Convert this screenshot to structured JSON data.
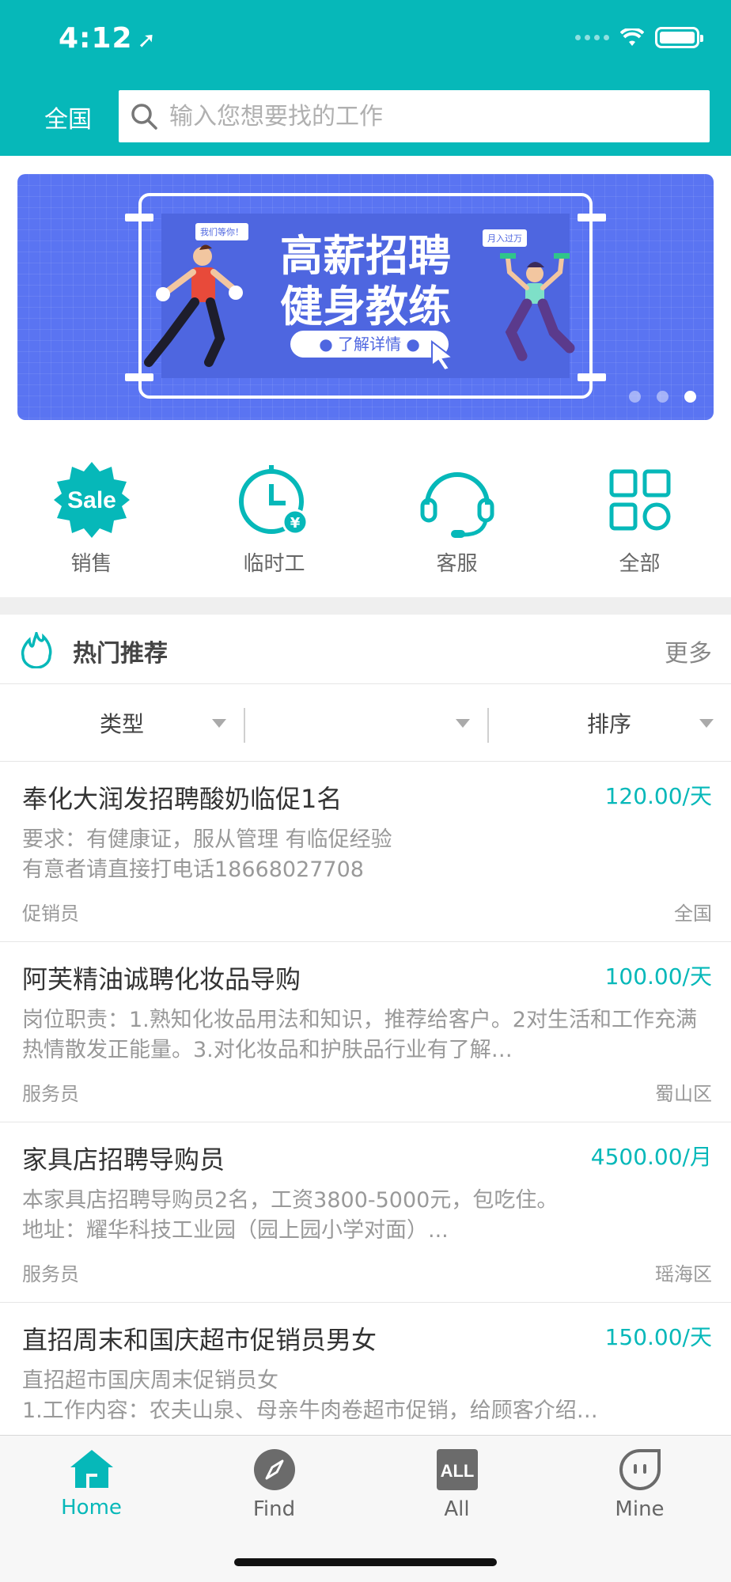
{
  "status_bar": {
    "time": "4:12"
  },
  "header": {
    "region": "全国",
    "search_placeholder": "输入您想要找的工作"
  },
  "banner": {
    "title_line1": "高薪招聘",
    "title_line2": "健身教练",
    "button": "● 了解详情 ●",
    "bubble_left": "我们等你！",
    "bubble_right": "月入过万",
    "page_count": 3,
    "active_page": 3
  },
  "categories": [
    {
      "label": "销售",
      "icon": "sale-badge-icon"
    },
    {
      "label": "临时工",
      "icon": "clock-yen-icon"
    },
    {
      "label": "客服",
      "icon": "headset-icon"
    },
    {
      "label": "全部",
      "icon": "grid-icon"
    }
  ],
  "hot": {
    "title": "热门推荐",
    "more": "更多"
  },
  "filters": [
    {
      "label": "类型"
    },
    {
      "label": ""
    },
    {
      "label": "排序"
    }
  ],
  "jobs": [
    {
      "title": "奉化大润发招聘酸奶临促1名",
      "salary": "120.00/天",
      "desc": "要求：有健康证，服从管理 有临促经验\n有意者请直接打电话18668027708",
      "category": "促销员",
      "area": "全国"
    },
    {
      "title": "阿芙精油诚聘化妆品导购",
      "salary": "100.00/天",
      "desc": "岗位职责：1.熟知化妆品用法和知识，推荐给客户。2对生活和工作充满热情散发正能量。3.对化妆品和护肤品行业有了解…",
      "category": "服务员",
      "area": "蜀山区"
    },
    {
      "title": "家具店招聘导购员",
      "salary": "4500.00/月",
      "desc": "本家具店招聘导购员2名，工资3800-5000元，包吃住。\n地址：耀华科技工业园（园上园小学对面）...",
      "category": "服务员",
      "area": "瑶海区"
    },
    {
      "title": "直招周末和国庆超市促销员男女",
      "salary": "150.00/天",
      "desc": "直招超市国庆周末促销员女\n1.工作内容：农夫山泉、母亲牛肉卷超市促销，给顾客介绍…",
      "category": "",
      "area": ""
    }
  ],
  "tabbar": [
    {
      "label": "Home",
      "icon": "home-icon",
      "active": true
    },
    {
      "label": "Find",
      "icon": "compass-icon",
      "active": false
    },
    {
      "label": "All",
      "icon": "all-icon",
      "active": false
    },
    {
      "label": "Mine",
      "icon": "profile-face-icon",
      "active": false
    }
  ],
  "colors": {
    "primary": "#06b8b9",
    "banner": "#5a74f2"
  }
}
